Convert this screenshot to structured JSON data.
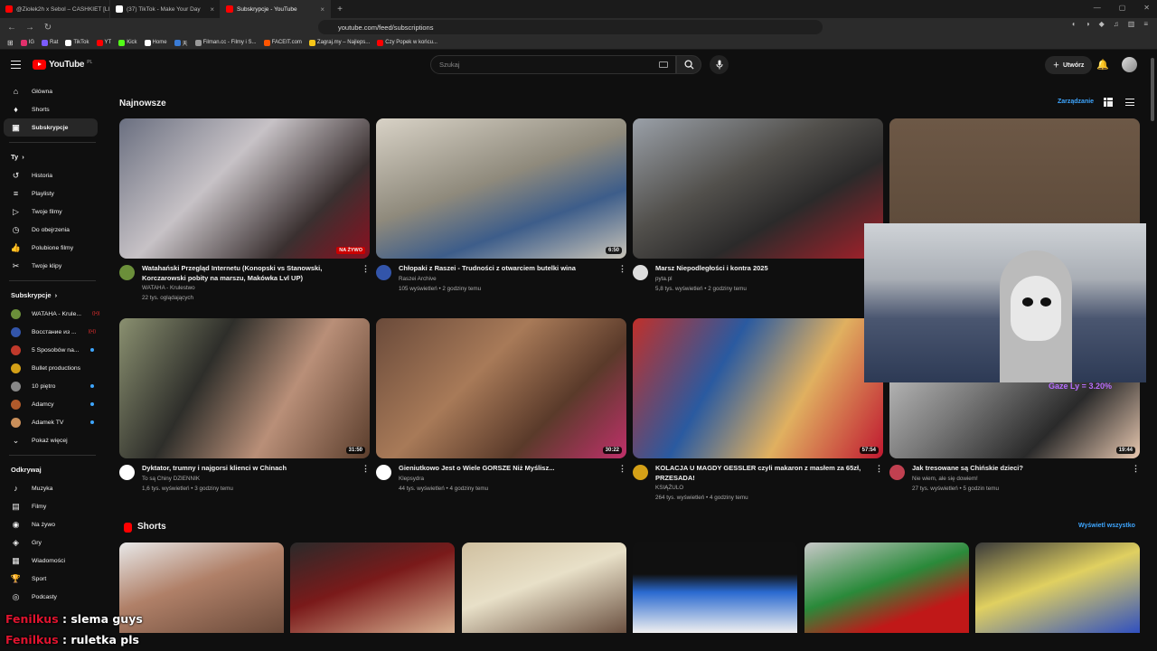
{
  "browser": {
    "tabs": [
      {
        "label": "@Ziolek2h x Sebol – CASHKIET [LIVE",
        "active": false,
        "favicon_color": "#ff0000"
      },
      {
        "label": "(37) TikTok - Make Your Day",
        "active": false,
        "favicon_color": "#ffffff"
      },
      {
        "label": "Subskrypcje - YouTube",
        "active": true,
        "favicon_color": "#ff0000"
      }
    ],
    "url": "youtube.com/feed/subscriptions",
    "bookmarks": [
      {
        "label": "IG",
        "color": "#e1306c"
      },
      {
        "label": "Rat",
        "color": "#7b5cff"
      },
      {
        "label": "TikTok",
        "color": "#ffffff"
      },
      {
        "label": "YT",
        "color": "#ff0000"
      },
      {
        "label": "Kick",
        "color": "#53fc18"
      },
      {
        "label": "Home",
        "color": "#ffffff"
      },
      {
        "label": "天",
        "color": "#3a7bd5"
      },
      {
        "label": "Filman.cc - Filmy i S...",
        "color": "#999999"
      },
      {
        "label": "FACEIT.com",
        "color": "#ff5500"
      },
      {
        "label": "Zagraj.my – Najleps...",
        "color": "#f5c518"
      },
      {
        "label": "Czy Popek w końcu...",
        "color": "#ff0000"
      }
    ]
  },
  "header": {
    "logo_text": "YouTube",
    "logo_region": "PL",
    "search_placeholder": "Szukaj",
    "create_label": "Utwórz"
  },
  "sidebar": {
    "main_items": [
      {
        "label": "Główna",
        "icon": "home-icon",
        "glyph": "⌂"
      },
      {
        "label": "Shorts",
        "icon": "shorts-icon",
        "glyph": "♦"
      },
      {
        "label": "Subskrypcje",
        "icon": "subscriptions-icon",
        "glyph": "▣",
        "active": true
      }
    ],
    "you_header": "Ty",
    "you_items": [
      {
        "label": "Historia",
        "icon": "history-icon",
        "glyph": "↺"
      },
      {
        "label": "Playlisty",
        "icon": "playlists-icon",
        "glyph": "≡"
      },
      {
        "label": "Twoje filmy",
        "icon": "your-videos-icon",
        "glyph": "▷"
      },
      {
        "label": "Do obejrzenia",
        "icon": "watch-later-icon",
        "glyph": "◷"
      },
      {
        "label": "Polubione filmy",
        "icon": "liked-icon",
        "glyph": "👍"
      },
      {
        "label": "Twoje klipy",
        "icon": "clips-icon",
        "glyph": "✂"
      }
    ],
    "subs_header": "Subskrypcje",
    "subs_items": [
      {
        "label": "WATAHA - Krule...",
        "color": "#6b8f3a",
        "status": "live"
      },
      {
        "label": "Восстание из ...",
        "color": "#3355aa",
        "status": "live"
      },
      {
        "label": "5 Sposobów na...",
        "color": "#c0392b",
        "status": "new"
      },
      {
        "label": "Bullet productions",
        "color": "#d4a017",
        "status": ""
      },
      {
        "label": "10 piętro",
        "color": "#888888",
        "status": "new"
      },
      {
        "label": "Adamcy",
        "color": "#b05a2b",
        "status": "new"
      },
      {
        "label": "Adamek TV",
        "color": "#c98f5a",
        "status": "new"
      }
    ],
    "show_more": "Pokaż więcej",
    "explore_header": "Odkrywaj",
    "explore_items": [
      {
        "label": "Muzyka",
        "icon": "music-icon",
        "glyph": "♪"
      },
      {
        "label": "Filmy",
        "icon": "movies-icon",
        "glyph": "▤"
      },
      {
        "label": "Na żywo",
        "icon": "live-icon",
        "glyph": "◉"
      },
      {
        "label": "Gry",
        "icon": "gaming-icon",
        "glyph": "◈"
      },
      {
        "label": "Wiadomości",
        "icon": "news-icon",
        "glyph": "▦"
      },
      {
        "label": "Sport",
        "icon": "sport-icon",
        "glyph": "🏆"
      },
      {
        "label": "Podcasty",
        "icon": "podcasts-icon",
        "glyph": "◎"
      }
    ]
  },
  "feed": {
    "section_title": "Najnowsze",
    "manage_label": "Zarządzanie",
    "videos": [
      {
        "title": "Watahański Przegląd Internetu (Konopski vs Stanowski, Korczarowski pobity na marszu, Makówka Lvl UP)",
        "channel": "WATAHA - Krulestwo",
        "stats": "22 tys. oglądających",
        "duration": "",
        "badge": "NA ŻYWO",
        "thumb": "linear-gradient(135deg,#6a6f80,#c7c2c6 40%,#3a3030 75%,#8a1020)",
        "av": "#6b8f3a"
      },
      {
        "title": "Chłopaki z Raszei - Trudności z otwarciem butelki wina",
        "channel": "Raszei Archive",
        "stats": "105 wyświetleń • 2 godziny temu",
        "duration": "6:50",
        "badge": "",
        "thumb": "linear-gradient(160deg,#d8d2c6,#8f8a7c 45%,#3d5d8a 70%,#c9c4b8)",
        "av": "#3355aa"
      },
      {
        "title": "Marsz Niepodległości i kontra 2025",
        "channel": "pyta.pl",
        "stats": "5,8 tys. wyświetleń • 2 godziny temu",
        "duration": "",
        "badge": "",
        "thumb": "linear-gradient(150deg,#9aa0a8,#52504c 40%,#2b2a2a 65%,#a8202a)",
        "av": "#dddddd"
      },
      {
        "title": "",
        "channel": "",
        "stats": "",
        "duration": "",
        "badge": "",
        "thumb": "linear-gradient(180deg,#6d5846,#5a4838)",
        "av": "#c98f5a"
      },
      {
        "title": "Dyktator, trumny i najgorsi klienci w Chinach",
        "channel": "To są Chiny DZIENNIK",
        "stats": "1,6 tys. wyświetleń • 3 godziny temu",
        "duration": "31:50",
        "badge": "",
        "thumb": "linear-gradient(120deg,#8a9070,#2e2e2a 35%,#b98f78 65%,#5a3d2c)",
        "av": "#ffffff"
      },
      {
        "title": "Gieniutkowo Jest o Wiele GORSZE Niż Myślisz...",
        "channel": "Klepsydra",
        "stats": "44 tys. wyświetleń • 4 godziny temu",
        "duration": "30:22",
        "badge": "",
        "thumb": "linear-gradient(135deg,#6a4a3a,#a87a58 40%,#5a3a2a 70%,#c0306a)",
        "av": "#ffffff"
      },
      {
        "title": "KOLACJA U MAGDY GESSLER czyli makaron z masłem za 65zł, PRZESADA!",
        "channel": "KSIĄŻULO",
        "stats": "264 tys. wyświetleń • 4 godziny temu",
        "duration": "57:54",
        "badge": "",
        "thumb": "linear-gradient(120deg,#c0302a,#2a5aa0 35%,#e0b060 65%,#c01830)",
        "av": "#d4a017"
      },
      {
        "title": "Jak tresowane są Chińskie dzieci?",
        "channel": "Nie wiem, ale się dowiem!",
        "stats": "27 tys. wyświetleń • 5 godzin temu",
        "duration": "19:44",
        "badge": "",
        "thumb": "linear-gradient(135deg,#d8d8d8,#7a7a7a 40%,#2a2a2a 70%,#e8c8b0)",
        "av": "#c04050"
      }
    ],
    "shorts_title": "Shorts",
    "view_all": "Wyświetl wszystko",
    "shorts": [
      {
        "thumb": "linear-gradient(160deg,#e8e8e8,#b08068 45%,#6a4a3a)"
      },
      {
        "thumb": "linear-gradient(160deg,#2a2a2a,#7a1a1a 45%,#d8b090)"
      },
      {
        "thumb": "linear-gradient(160deg,#d0c0a0,#e8e0c8 45%,#6a5040)"
      },
      {
        "thumb": "linear-gradient(180deg,#101010,#101010 35%,#2a6ad0 55%,#f0f0f0)"
      },
      {
        "thumb": "linear-gradient(160deg,#c8c8c8,#2a8a3a 45%,#c01818 75%)"
      },
      {
        "thumb": "linear-gradient(160deg,#3a3a3a,#e0d060 45%,#3050c0)"
      }
    ]
  },
  "overlay": {
    "stream_text": "Gaze Ly = 3.20%",
    "chat": [
      {
        "user": "Fenilkus",
        "message": "slema guys"
      },
      {
        "user": "Fenilkus",
        "message": "ruletka pls"
      }
    ]
  }
}
